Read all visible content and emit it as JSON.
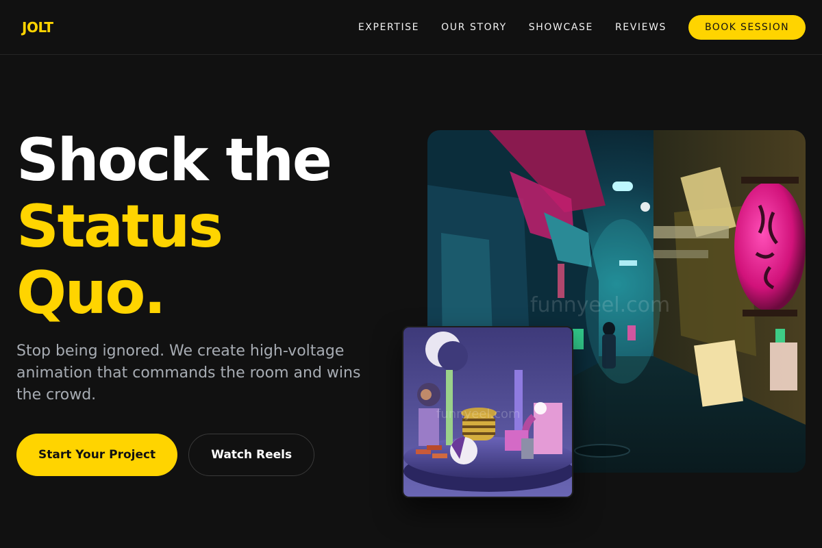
{
  "brand": {
    "logo": "JOLT",
    "accent_color": "#FFD400"
  },
  "nav": {
    "links": [
      "EXPERTISE",
      "OUR STORY",
      "SHOWCASE",
      "REVIEWS"
    ],
    "cta_label": "BOOK SESSION"
  },
  "hero": {
    "headline_line1": "Shock the",
    "headline_line2": "Status",
    "headline_line3": "Quo.",
    "subtext": "Stop being ignored. We create high-voltage animation that commands the room and wins the crowd.",
    "primary_cta": "Start Your Project",
    "secondary_cta": "Watch Reels"
  },
  "images": {
    "main": {
      "subject": "neon-lit night alley with lanterns",
      "watermark": "funnyeel.com"
    },
    "card": {
      "subject": "3D abstract shapes on a purple platform",
      "watermark": "funnyeel.com"
    }
  },
  "colors": {
    "background": "#111111",
    "text": "#ffffff",
    "muted_text": "#a7acb3"
  }
}
